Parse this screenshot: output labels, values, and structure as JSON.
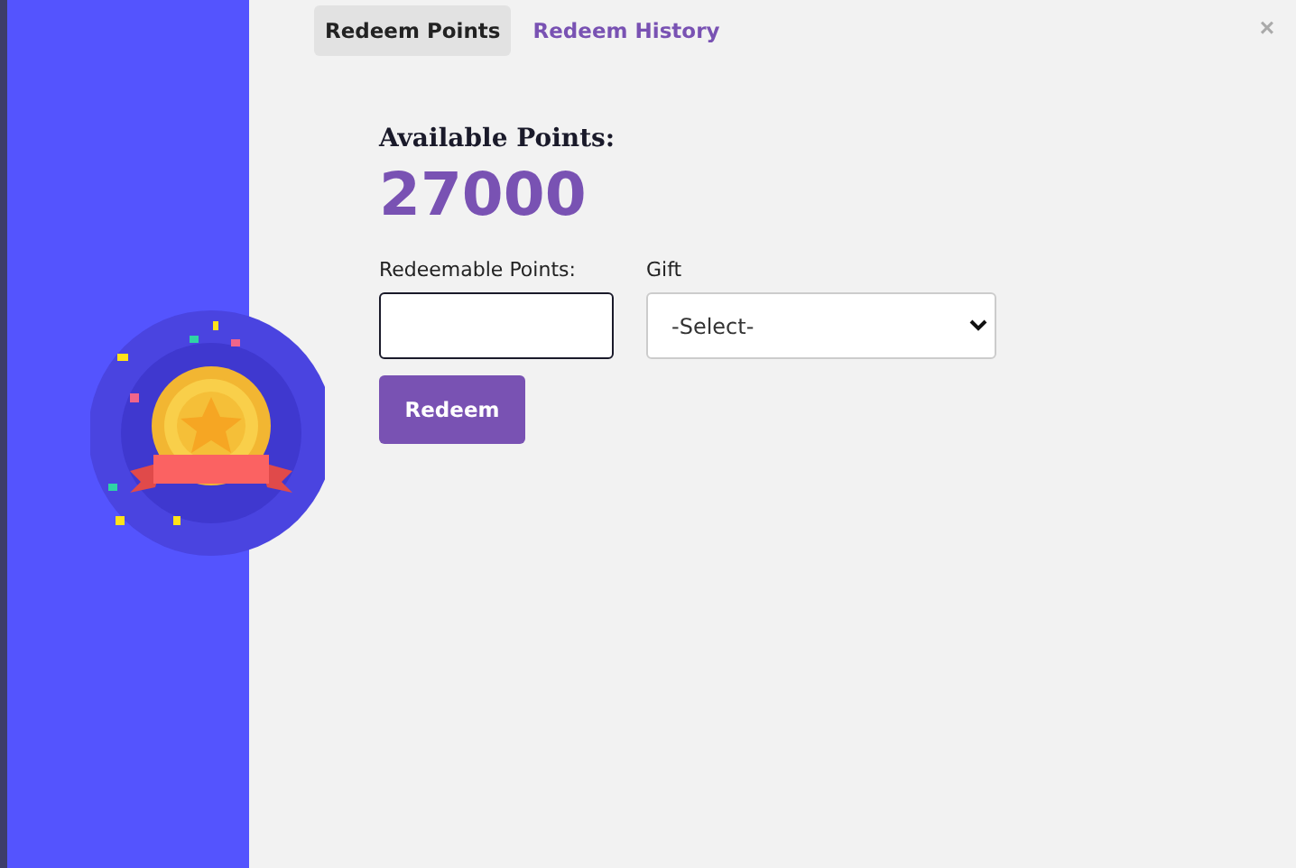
{
  "tabs": [
    {
      "label": "Redeem Points",
      "selected": true
    },
    {
      "label": "Redeem History",
      "selected": false
    }
  ],
  "close": "×",
  "available": {
    "label": "Available Points:",
    "value": "27000"
  },
  "fields": [
    {
      "kind": "input",
      "label": "Redeemable Points:"
    },
    {
      "kind": "select",
      "label": "Gift",
      "value": "-Select-"
    }
  ],
  "button": "Redeem"
}
